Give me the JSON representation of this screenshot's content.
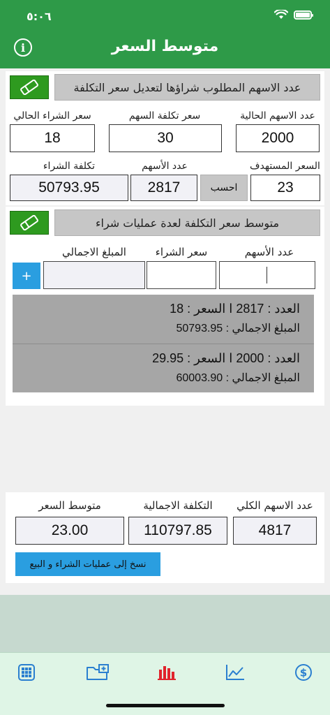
{
  "status": {
    "time": "٥:٠٦"
  },
  "header": {
    "title": "متوسط السعر"
  },
  "section1": {
    "title": "عدد الاسهم المطلوب شراؤها لتعديل سعر التكلفة",
    "current_shares_label": "عدد الاسهم الحالية",
    "current_shares_value": "2000",
    "share_cost_label": "سعر تكلفة السهم",
    "share_cost_value": "30",
    "current_price_label": "سعر الشراء الحالي",
    "current_price_value": "18",
    "target_price_label": "السعر المستهدف",
    "target_price_value": "23",
    "calc_label": "احسب",
    "shares_count_label": "عدد الأسهم",
    "shares_count_value": "2817",
    "purchase_cost_label": "تكلفة الشراء",
    "purchase_cost_value": "50793.95"
  },
  "section2": {
    "title": "متوسط سعر التكلفة لعدة عمليات شراء",
    "shares_col_label": "عدد الأسهم",
    "price_col_label": "سعر الشراء",
    "total_col_label": "المبلغ الاجمالي",
    "add_label": "+",
    "entries": [
      {
        "line1": "العدد : 2817    ا    السعر : 18",
        "line2": "المبلغ الاجمالي : 50793.95"
      },
      {
        "line1": "العدد : 2000    ا    السعر : 29.95",
        "line2": "المبلغ الاجمالي : 60003.90"
      }
    ]
  },
  "summary": {
    "total_shares_label": "عدد الاسهم الكلي",
    "total_shares_value": "4817",
    "total_cost_label": "التكلفة الاجمالية",
    "total_cost_value": "110797.85",
    "avg_price_label": "متوسط السعر",
    "avg_price_value": "23.00",
    "copy_label": "نسخ إلى عمليات الشراء و البيع"
  },
  "tabbar": {
    "icons": [
      "calculator-icon",
      "folder-add-icon",
      "bar-chart-icon",
      "line-chart-icon",
      "dollar-icon"
    ],
    "active_color": "#e0242c",
    "inactive_color": "#2a7fd0"
  },
  "colors": {
    "header": "#2e9a48",
    "eraser": "#2e9a1f",
    "accent_blue": "#2a9ee0"
  }
}
